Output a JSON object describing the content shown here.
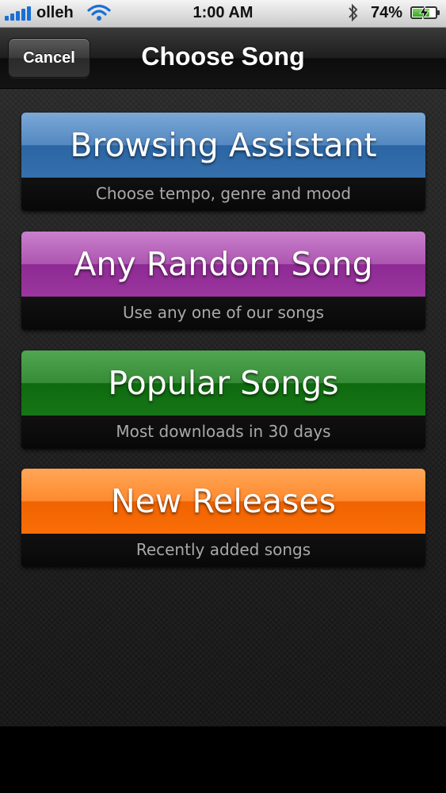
{
  "status_bar": {
    "carrier": "olleh",
    "time": "1:00 AM",
    "battery_percent": "74%",
    "battery_level": 0.74,
    "signal_bars": 5,
    "icons": [
      "signal-bars-icon",
      "wifi-icon",
      "bluetooth-icon",
      "battery-icon",
      "charging-bolt-icon"
    ]
  },
  "nav": {
    "cancel_label": "Cancel",
    "title": "Choose Song"
  },
  "options": [
    {
      "title": "Browsing Assistant",
      "subtitle": "Choose tempo, genre and mood",
      "color": "#3c78b8"
    },
    {
      "title": "Any Random Song",
      "subtitle": "Use any one of our songs",
      "color": "#a23fa6"
    },
    {
      "title": "Popular Songs",
      "subtitle": "Most downloads in 30 days",
      "color": "#1b7d1b"
    },
    {
      "title": "New Releases",
      "subtitle": "Recently added songs",
      "color": "#ff7a12"
    }
  ]
}
